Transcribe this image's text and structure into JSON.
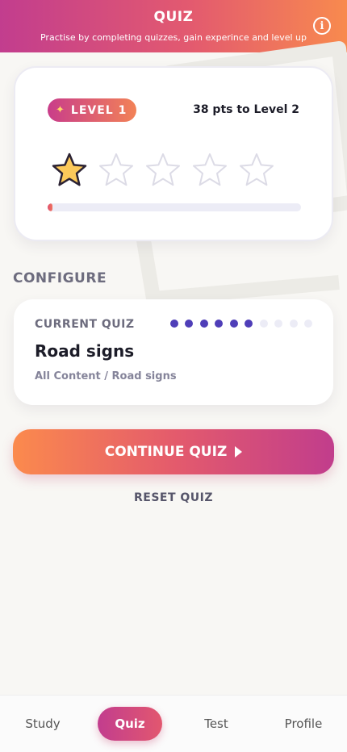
{
  "header": {
    "title": "QUIZ",
    "subtitle": "Practise by completing quizzes, gain experince and level up",
    "info_icon": "info-icon"
  },
  "level": {
    "badge_label": "LEVEL 1",
    "points_to_next": "38 pts to Level 2",
    "stars_filled": 1,
    "stars_total": 5,
    "progress_fraction": 0.02
  },
  "configure": {
    "section_title": "CONFIGURE",
    "current_quiz_label": "CURRENT QUIZ",
    "quiz_name": "Road signs",
    "quiz_path": "All Content / Road signs",
    "dots_filled": 6,
    "dots_total": 10
  },
  "actions": {
    "continue_label": "CONTINUE QUIZ",
    "reset_label": "RESET QUIZ"
  },
  "tabs": [
    {
      "label": "Study",
      "active": false
    },
    {
      "label": "Quiz",
      "active": true
    },
    {
      "label": "Test",
      "active": false
    },
    {
      "label": "Profile",
      "active": false
    }
  ],
  "colors": {
    "accent_pink": "#c23d8e",
    "accent_orange": "#f88a4e",
    "dot_active": "#4f3eb8",
    "star_fill": "#fcc95a"
  }
}
